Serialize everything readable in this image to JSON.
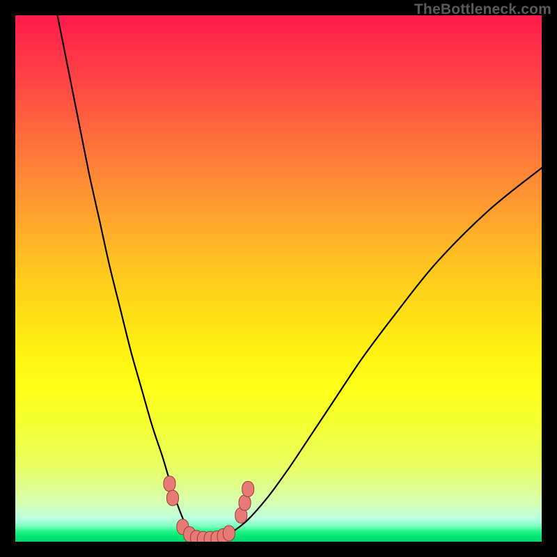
{
  "watermark": {
    "text": "TheBottleneck.com"
  },
  "colors": {
    "background": "#000000",
    "curve": "#000000",
    "marker_fill": "#e77a74",
    "marker_stroke": "#903f3e"
  },
  "chart_data": {
    "type": "line",
    "title": "",
    "xlabel": "",
    "ylabel": "",
    "xlim": [
      0,
      100
    ],
    "ylim": [
      0,
      100
    ],
    "note": "Valley-shaped bottleneck curve; y-axis inverted visually (0 = bottom = best). Values estimated from pixels (no axes present).",
    "series": [
      {
        "name": "bottleneck-curve",
        "x": [
          8,
          10,
          12,
          14,
          16,
          18,
          20,
          22,
          24,
          26,
          28,
          29.5,
          31,
          32.5,
          34,
          36,
          38,
          40,
          44,
          48,
          52,
          56,
          60,
          66,
          72,
          80,
          90,
          100
        ],
        "y": [
          100,
          90,
          80,
          70,
          61,
          52,
          44,
          36,
          29,
          22,
          16,
          11,
          6.5,
          3,
          1,
          0,
          0,
          1,
          4,
          8.5,
          14,
          20,
          26,
          35,
          43,
          53,
          63,
          71
        ]
      }
    ],
    "markers": {
      "name": "highlighted-points",
      "description": "Salmon rounded markers near the valley floor",
      "points": [
        {
          "x": 29.3,
          "y": 11.0
        },
        {
          "x": 29.9,
          "y": 8.3
        },
        {
          "x": 31.8,
          "y": 2.8
        },
        {
          "x": 33.1,
          "y": 1.4
        },
        {
          "x": 34.4,
          "y": 0.7
        },
        {
          "x": 35.7,
          "y": 0.5
        },
        {
          "x": 37.0,
          "y": 0.5
        },
        {
          "x": 38.3,
          "y": 0.6
        },
        {
          "x": 39.5,
          "y": 1.0
        },
        {
          "x": 40.6,
          "y": 1.6
        },
        {
          "x": 42.9,
          "y": 5.0
        },
        {
          "x": 43.6,
          "y": 7.4
        },
        {
          "x": 44.2,
          "y": 10.0
        }
      ]
    }
  }
}
